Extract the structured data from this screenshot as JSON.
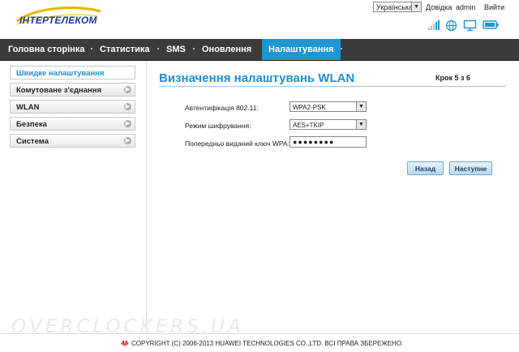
{
  "header": {
    "logo_text": "ІНТЕРТЕЛЕКОМ",
    "language": "Українська",
    "links": [
      "Довідка",
      "admin",
      "Вийти"
    ],
    "status_icons": [
      "signal-strength-icon",
      "globe-icon",
      "monitor-icon",
      "battery-icon"
    ]
  },
  "nav": {
    "items": [
      "Головна сторінка",
      "Статистика",
      "SMS",
      "Оновлення",
      "Налаштування"
    ],
    "active": "Налаштування"
  },
  "sidebar": {
    "items": [
      {
        "label": "Швидке налаштування",
        "active": true
      },
      {
        "label": "Комутоване з'єднання",
        "active": false
      },
      {
        "label": "WLAN",
        "active": false
      },
      {
        "label": "Безпека",
        "active": false
      },
      {
        "label": "Система",
        "active": false
      }
    ]
  },
  "main": {
    "title": "Визначення налаштувань WLAN",
    "step": "Крок 5 з 6",
    "fields": {
      "auth_label": "Автентифікація 802.11:",
      "auth_value": "WPA2-PSK",
      "encryption_label": "Режим шифрування:",
      "encryption_value": "AES+TKIP",
      "wpa_key_label": "Попередньо виданий ключ WPA:",
      "wpa_key_value": "●●●●●●●●"
    },
    "buttons": {
      "back": "Назад",
      "next": "Наступне"
    }
  },
  "footer": {
    "copyright": "COPYRIGHT (C) 2006-2013 HUAWEI TECHNOLOGIES CO.,LTD. ВСІ ПРАВА ЗБЕРЕЖЕНО.",
    "watermark": "OVERCLOCKERS.UA"
  },
  "colors": {
    "accent": "#1e96d2",
    "navbar": "#3b3b3b"
  }
}
